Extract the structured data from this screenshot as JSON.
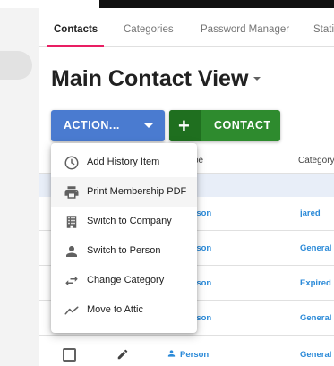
{
  "tabs": [
    {
      "label": "Contacts",
      "active": true
    },
    {
      "label": "Categories"
    },
    {
      "label": "Password Manager"
    },
    {
      "label": "Stati"
    }
  ],
  "page": {
    "title": "Main Contact View"
  },
  "toolbar": {
    "action_label": "ACTION...",
    "contact_label": "CONTACT",
    "plus_glyph": "+"
  },
  "table": {
    "columns": [
      "pe",
      "Category"
    ],
    "rows": [
      {
        "name": "Person",
        "category": "jared"
      },
      {
        "name": "Person",
        "category": "General"
      },
      {
        "name": "Person",
        "category": "Expired l"
      },
      {
        "name": "Person",
        "category": "General"
      },
      {
        "name": "Person",
        "category": "General"
      }
    ]
  },
  "action_menu": {
    "items": [
      {
        "label": "Add History Item",
        "icon": "history-clock-icon"
      },
      {
        "label": "Print Membership PDF",
        "icon": "printer-icon"
      },
      {
        "label": "Switch to Company",
        "icon": "building-icon"
      },
      {
        "label": "Switch to Person",
        "icon": "person-icon"
      },
      {
        "label": "Change Category",
        "icon": "swap-arrows-icon"
      },
      {
        "label": "Move to Attic",
        "icon": "attic-icon"
      }
    ]
  },
  "colors": {
    "action_button": "#4a7bd0",
    "contact_button": "#2e8b2e",
    "active_tab_underline": "#e91e63",
    "link": "#2b8ad8"
  }
}
